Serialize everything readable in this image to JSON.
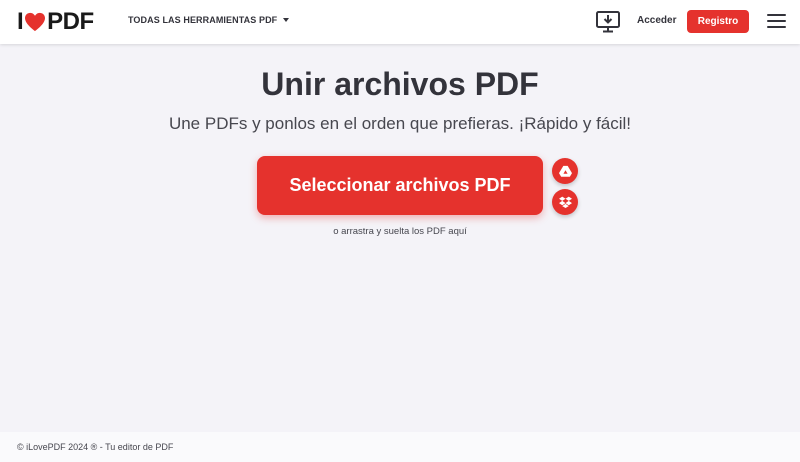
{
  "header": {
    "logo_prefix": "I",
    "logo_suffix": "PDF",
    "tools_menu_label": "TODAS LAS HERRAMIENTAS PDF",
    "login_label": "Acceder",
    "register_label": "Registro"
  },
  "main": {
    "title": "Unir archivos PDF",
    "subtitle": "Une PDFs y ponlos en el orden que prefieras. ¡Rápido y fácil!",
    "select_button_label": "Seleccionar archivos PDF",
    "drop_hint": "o arrastra y suelta los PDF aquí"
  },
  "footer": {
    "copyright": "© iLovePDF 2024 ® - Tu editor de PDF"
  },
  "colors": {
    "brand_red": "#e5322d",
    "background": "#f4f3f8",
    "text": "#33333b"
  },
  "icons": [
    "heart-icon",
    "caret-down-icon",
    "desktop-download-icon",
    "hamburger-menu-icon",
    "google-drive-icon",
    "dropbox-icon"
  ]
}
